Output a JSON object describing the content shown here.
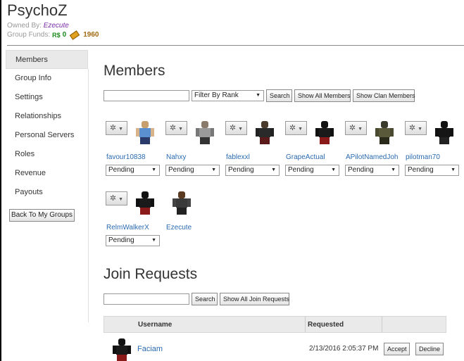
{
  "header": {
    "group_name": "PsychoZ",
    "owned_by_label": "Owned By:",
    "owner_name": "Ezecute",
    "funds_label": "Group Funds:",
    "robux_symbol": "R$",
    "robux_value": "0",
    "tickets_value": "1960"
  },
  "sidebar": {
    "items": [
      {
        "label": "Members",
        "active": true
      },
      {
        "label": "Group Info"
      },
      {
        "label": "Settings"
      },
      {
        "label": "Relationships"
      },
      {
        "label": "Personal Servers"
      },
      {
        "label": "Roles"
      },
      {
        "label": "Revenue"
      },
      {
        "label": "Payouts"
      }
    ],
    "back_label": "Back To My Groups"
  },
  "members": {
    "title": "Members",
    "search_value": "",
    "filter_selected": "Filter By Rank",
    "search_label": "Search",
    "show_all_label": "Show All Members",
    "show_clan_label": "Show Clan Members",
    "list": [
      {
        "name": "favour10838",
        "rank": "Pending",
        "avatar": "blue-shirt-avatar"
      },
      {
        "name": "Nahxy",
        "rank": "Pending",
        "avatar": "grey-avatar"
      },
      {
        "name": "fablexxl",
        "rank": "Pending",
        "avatar": "dark-avatar"
      },
      {
        "name": "GrapeActual",
        "rank": "Pending",
        "avatar": "black-red-avatar"
      },
      {
        "name": "APilotNamedJoh",
        "rank": "Pending",
        "avatar": "olive-avatar"
      },
      {
        "name": "pilotman70",
        "rank": "Pending",
        "avatar": "black-avatar"
      },
      {
        "name": "RelmWalkerX",
        "rank": "Pending",
        "avatar": "black-red-avatar"
      },
      {
        "name": "Ezecute",
        "rank": "",
        "avatar": "brown-avatar"
      }
    ]
  },
  "join_requests": {
    "title": "Join Requests",
    "search_value": "",
    "search_label": "Search",
    "show_all_label": "Show All Join Requests",
    "col_username": "Username",
    "col_requested": "Requested",
    "rows": [
      {
        "username": "Faciam",
        "requested": "2/13/2016 2:05:37 PM",
        "accept_label": "Accept",
        "decline_label": "Decline"
      }
    ]
  },
  "colors": {
    "link": "#2a6ab0",
    "owner": "#7a2ca8",
    "robux": "#1a8a1a"
  }
}
